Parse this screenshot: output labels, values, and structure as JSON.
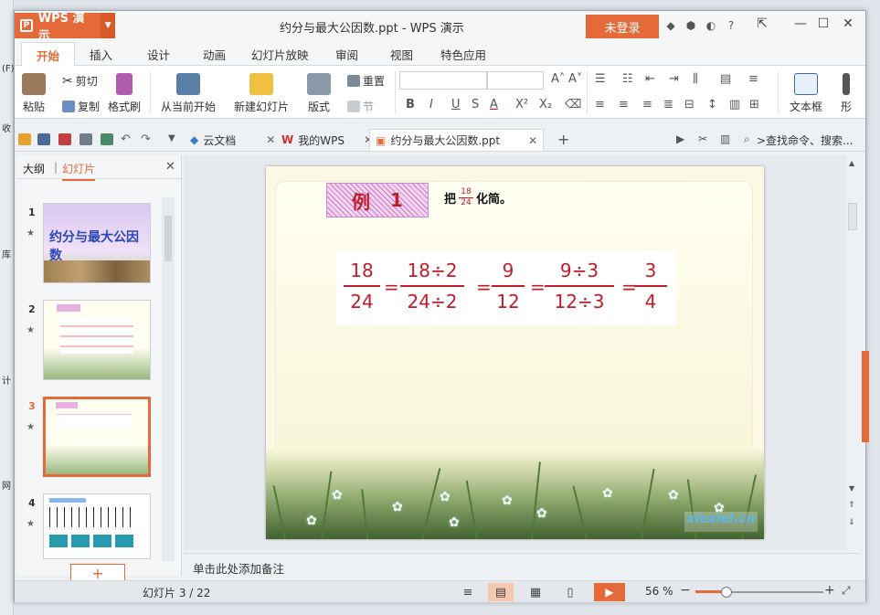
{
  "desktop_strip": {
    "labels": [
      "(F)",
      "收",
      "库",
      "计",
      "网"
    ]
  },
  "app": {
    "logo": "WPS 演示",
    "logo_letter": "P",
    "window_title": "约分与最大公因数.ppt - WPS 演示",
    "login": "未登录"
  },
  "ribbon_tabs": [
    "开始",
    "插入",
    "设计",
    "动画",
    "幻灯片放映",
    "审阅",
    "视图",
    "特色应用"
  ],
  "ribbon": {
    "paste": "粘贴",
    "cut": "剪切",
    "copy": "复制",
    "format_painter": "格式刷",
    "from_current": "从当前开始",
    "new_slide": "新建幻灯片",
    "layout": "版式",
    "reset": "重置",
    "section": "节",
    "textbox": "文本框",
    "shape": "形"
  },
  "doc_tabs": [
    {
      "label": "云文档"
    },
    {
      "label": "我的WPS"
    },
    {
      "label": "约分与最大公因数.ppt"
    }
  ],
  "search_placeholder": ">查找命令、搜索...",
  "panel": {
    "tab_outline": "大纲",
    "tab_slides": "幻灯片",
    "add": "+"
  },
  "thumbnails": [
    {
      "num": "1",
      "title": "约分与最大公因数"
    },
    {
      "num": "2",
      "title": ""
    },
    {
      "num": "3",
      "title": ""
    },
    {
      "num": "4",
      "title": ""
    }
  ],
  "slide": {
    "example_label": "例",
    "example_num": "1",
    "instruction_pre": "把",
    "instruction_num": "18",
    "instruction_den": "24",
    "instruction_post": "化简。",
    "steps": [
      {
        "num": "18",
        "den": "24"
      },
      {
        "num": "18÷2",
        "den": "24÷2"
      },
      {
        "num": "9",
        "den": "12"
      },
      {
        "num": "9÷3",
        "den": "12÷3"
      },
      {
        "num": "3",
        "den": "4"
      }
    ],
    "equals": "=",
    "watermark": "xiexiel.cn"
  },
  "notes_placeholder": "单击此处添加备注",
  "status": {
    "slide_info": "幻灯片 3 / 22",
    "zoom": "56 %"
  },
  "colors": {
    "accent": "#e46a3a",
    "math_red": "#c01c2c"
  }
}
